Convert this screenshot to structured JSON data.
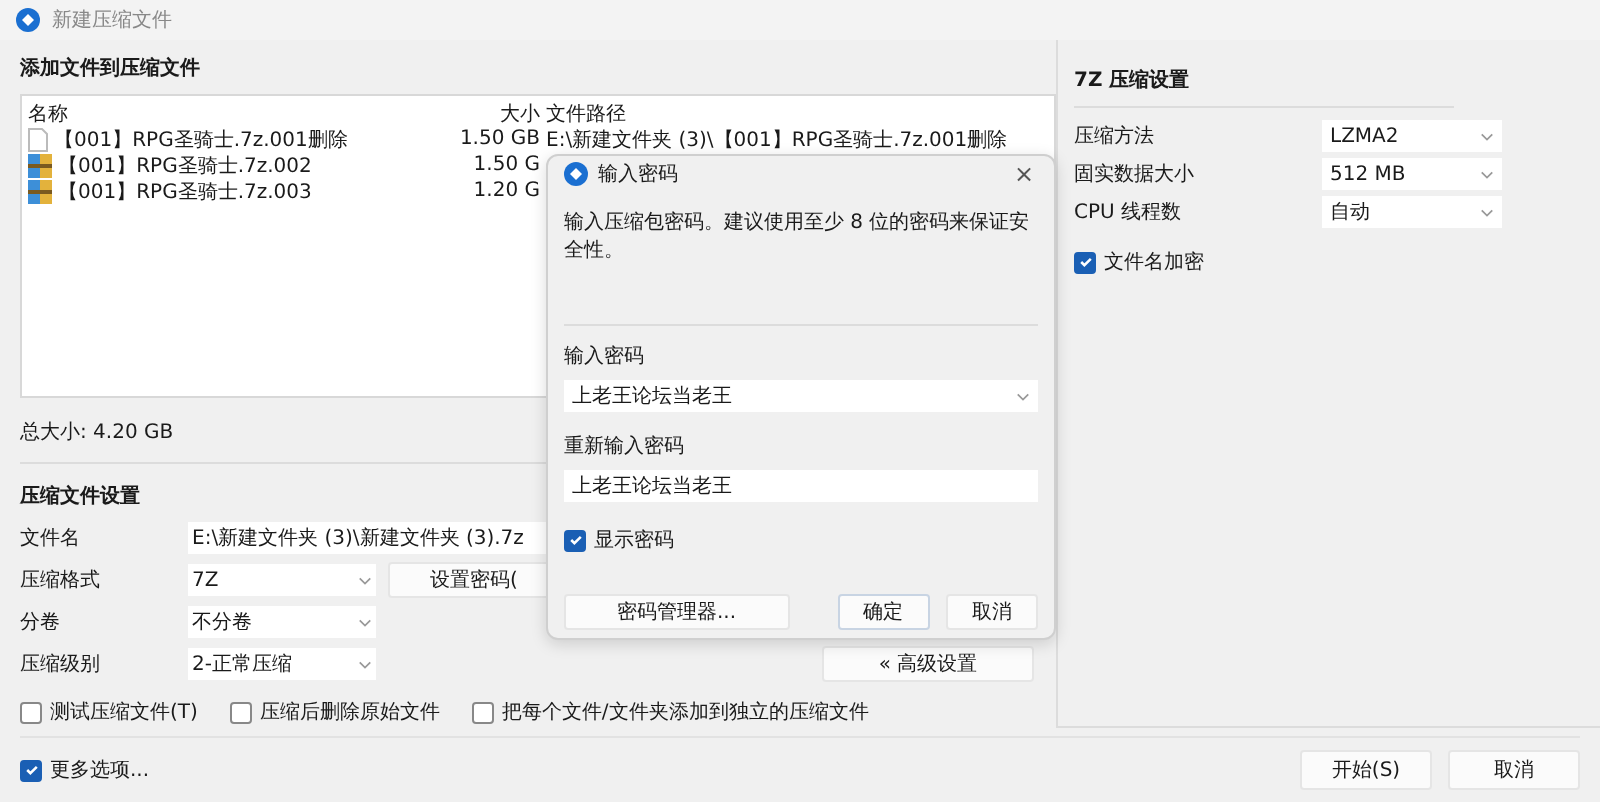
{
  "window": {
    "title": "新建压缩文件"
  },
  "files": {
    "heading": "添加文件到压缩文件",
    "columns": [
      "名称",
      "大小",
      "文件路径"
    ],
    "rows": [
      {
        "kind": "file",
        "name": "【001】RPG圣骑士.7z.001删除",
        "size": "1.50 GB",
        "path": "E:\\新建文件夹 (3)\\【001】RPG圣骑士.7z.001删除"
      },
      {
        "kind": "archive",
        "name": "【001】RPG圣骑士.7z.002",
        "size": "1.50 G"
      },
      {
        "kind": "archive",
        "name": "【001】RPG圣骑士.7z.003",
        "size": "1.20 G"
      }
    ],
    "total": "总大小: 4.20 GB"
  },
  "settings": {
    "heading": "压缩文件设置",
    "filename": {
      "label": "文件名",
      "value": "E:\\新建文件夹 (3)\\新建文件夹 (3).7z"
    },
    "dropdowns": [
      {
        "label": "压缩格式",
        "value": "7Z"
      },
      {
        "label": "分卷",
        "value": "不分卷"
      },
      {
        "label": "压缩级别",
        "value": "2-正常压缩"
      }
    ],
    "set_password_button": "设置密码(",
    "advanced_button": "« 高级设置",
    "options": [
      {
        "label": "测试压缩文件(T)",
        "checked": false
      },
      {
        "label": "压缩后删除原始文件",
        "checked": false
      },
      {
        "label": "把每个文件/文件夹添加到独立的压缩文件",
        "checked": false
      }
    ]
  },
  "more_options": {
    "label": "更多选项...",
    "checked": true
  },
  "advanced": {
    "heading": "7Z 压缩设置",
    "dropdowns": [
      {
        "label": "压缩方法",
        "value": "LZMA2"
      },
      {
        "label": "固实数据大小",
        "value": "512 MB"
      },
      {
        "label": "CPU 线程数",
        "value": "自动"
      }
    ],
    "encrypt_names": {
      "label": "文件名加密",
      "checked": true
    }
  },
  "buttons": [
    "开始(S)",
    "取消"
  ],
  "dialog": {
    "title": "输入密码",
    "close": "×",
    "hint": "输入压缩包密码。建议使用至少 8 位的密码来保证安全性。",
    "password_label": "输入密码",
    "password": "上老王论坛当老王",
    "confirm_label": "重新输入密码",
    "confirm": "上老王论坛当老王",
    "show_password": {
      "label": "显示密码",
      "checked": true
    },
    "manager_button": "密码管理器...",
    "ok_button": "确定",
    "cancel_button": "取消"
  }
}
